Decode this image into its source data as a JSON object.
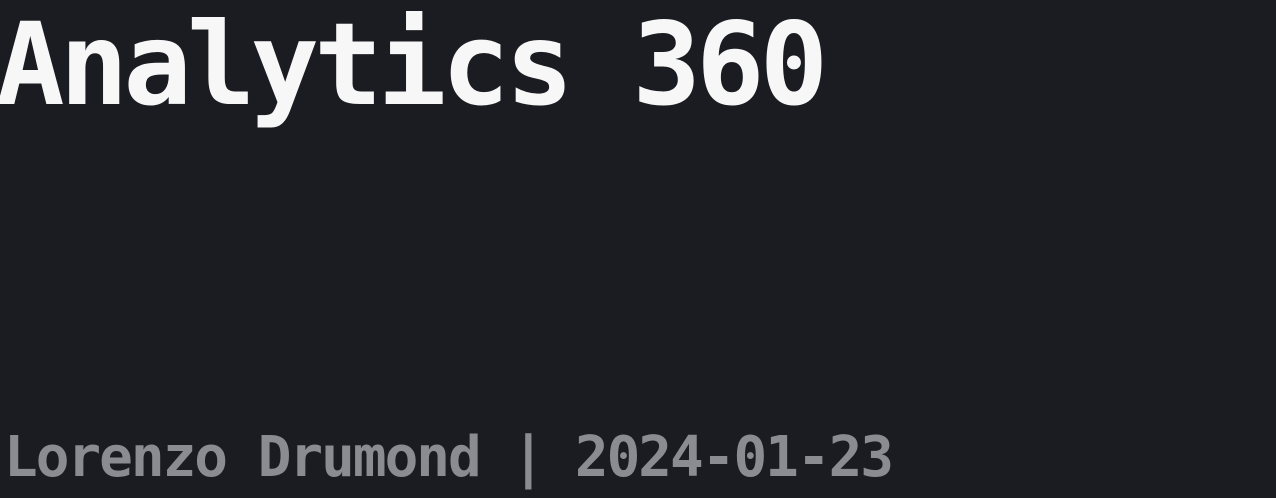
{
  "slide": {
    "title": "Analytics 360",
    "byline": "Lorenzo Drumond | 2024-01-23"
  },
  "colors": {
    "background": "#1b1c21",
    "title": "#f7f7f8",
    "byline": "#8b8c92"
  }
}
